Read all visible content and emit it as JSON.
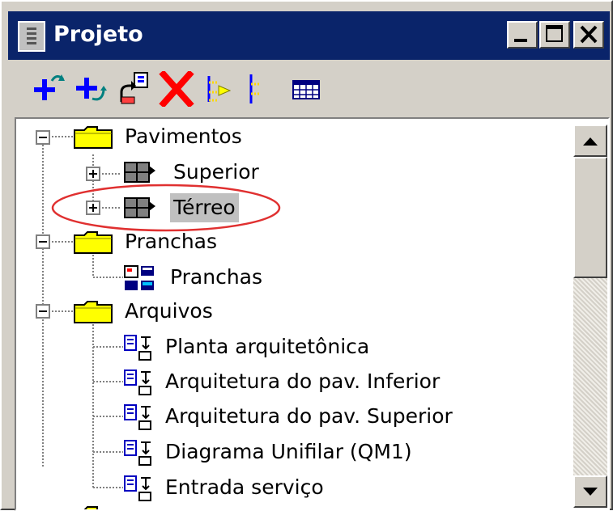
{
  "window": {
    "title": "Projeto"
  },
  "toolbar": {
    "icons": [
      "add-item-icon",
      "add-subitem-icon",
      "edit-icon",
      "delete-icon",
      "tree-layout-icon",
      "tree-branch-icon",
      "table-icon"
    ]
  },
  "tree": {
    "items": [
      {
        "label": "Pavimentos",
        "icon": "folder-icon"
      },
      {
        "label": "Superior",
        "icon": "floor-icon"
      },
      {
        "label": "Térreo",
        "icon": "floor-icon"
      },
      {
        "label": "Pranchas",
        "icon": "folder-icon"
      },
      {
        "label": "Pranchas",
        "icon": "sheets-icon"
      },
      {
        "label": "Arquivos",
        "icon": "folder-icon"
      },
      {
        "label": "Planta arquitetônica",
        "icon": "file-link-icon"
      },
      {
        "label": "Arquitetura do pav. Inferior",
        "icon": "file-link-icon"
      },
      {
        "label": "Arquitetura do pav. Superior",
        "icon": "file-link-icon"
      },
      {
        "label": "Diagrama Unifilar (QM1)",
        "icon": "file-link-icon"
      },
      {
        "label": "Entrada serviço",
        "icon": "file-link-icon"
      }
    ]
  },
  "colors": {
    "titlebar": "#0a246a",
    "highlight_ellipse": "#e03030",
    "folder": "#ffff00"
  }
}
